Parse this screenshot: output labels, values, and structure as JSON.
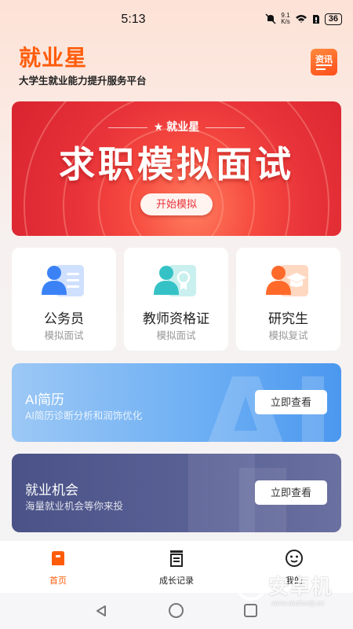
{
  "status_bar": {
    "time": "5:13",
    "net_speed_value": "9.1",
    "net_speed_unit": "K/s",
    "battery": "36"
  },
  "header": {
    "title": "就业星",
    "subtitle": "大学生就业能力提升服务平台",
    "news_label": "资讯"
  },
  "banner": {
    "tag": "就业星",
    "title": "求职模拟面试",
    "button": "开始模拟"
  },
  "cards": [
    {
      "title": "公务员",
      "subtitle": "模拟面试",
      "icon": "user-list-icon"
    },
    {
      "title": "教师资格证",
      "subtitle": "模拟面试",
      "icon": "certificate-icon"
    },
    {
      "title": "研究生",
      "subtitle": "模拟复试",
      "icon": "graduation-cap-icon"
    }
  ],
  "features": [
    {
      "title": "AI简历",
      "subtitle": "AI简历诊断分析和润饰优化",
      "button": "立即查看",
      "deco": "AI"
    },
    {
      "title": "就业机会",
      "subtitle": "海量就业机会等你来投",
      "button": "立即查看"
    }
  ],
  "tabs": [
    {
      "label": "首页",
      "active": true
    },
    {
      "label": "成长记录",
      "active": false
    },
    {
      "label": "我的",
      "active": false
    }
  ],
  "watermark": {
    "text": "安卓机",
    "url": "www.anzhuoji.cn"
  },
  "colors": {
    "brand": "#ff5c0a",
    "banner_red": "#e8333a",
    "ai_blue": "#6fb0f4",
    "job_indigo": "#4a5287"
  }
}
